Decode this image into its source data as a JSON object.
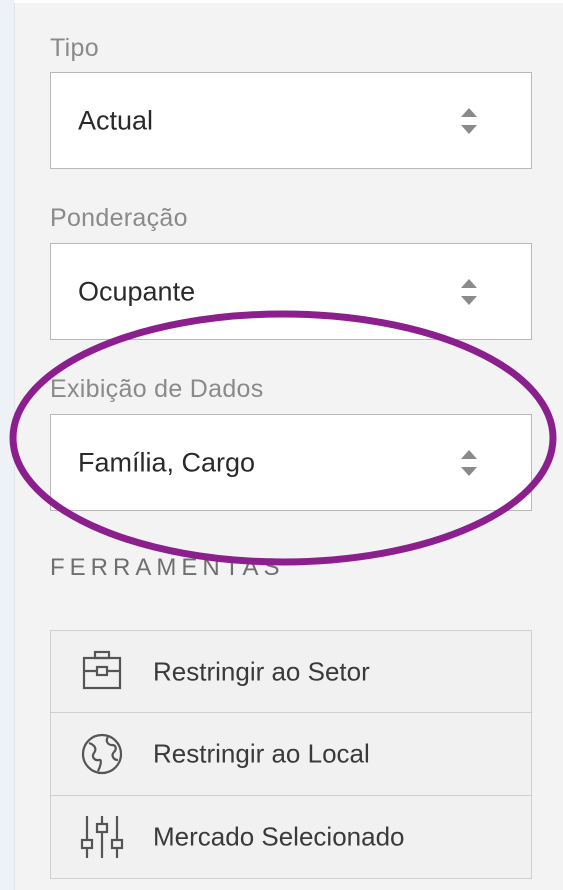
{
  "fields": {
    "tipo": {
      "label": "Tipo",
      "value": "Actual"
    },
    "ponderacao": {
      "label": "Ponderação",
      "value": "Ocupante"
    },
    "exibicao": {
      "label": "Exibição de Dados",
      "value": "Família, Cargo"
    }
  },
  "tools": {
    "title": "FERRAMENTAS",
    "items": [
      {
        "label": "Restringir ao Setor",
        "icon": "briefcase-icon"
      },
      {
        "label": "Restringir ao Local",
        "icon": "globe-icon"
      },
      {
        "label": "Mercado Selecionado",
        "icon": "sliders-icon"
      }
    ]
  },
  "colors": {
    "highlight": "#8c1f8e",
    "background": "#f3f3f3",
    "box_border": "#b9b9b9"
  }
}
